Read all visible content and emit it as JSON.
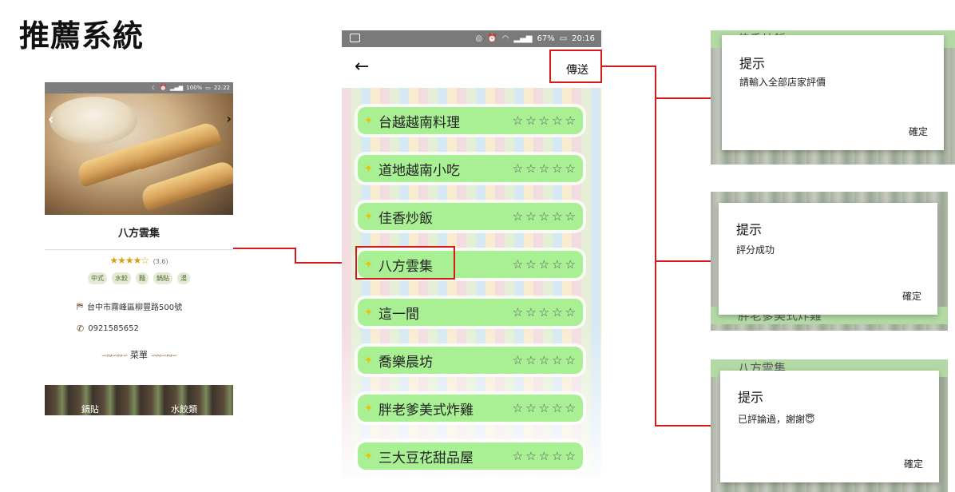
{
  "slide_title": "推薦系統",
  "left_phone": {
    "status_time": "22:22",
    "status_battery": "100%",
    "store_name": "八方雲集",
    "stars": "★★★★☆",
    "rating": "(3.6)",
    "tags": [
      "中式",
      "水餃",
      "麵",
      "鍋貼",
      "湯"
    ],
    "address": "台中市霧峰區柳豐路500號",
    "phone": "0921585652",
    "menu_title": "菜單",
    "menu_categories": [
      "鍋貼",
      "水餃類"
    ]
  },
  "mid_phone": {
    "status_battery": "67%",
    "status_time": "20:16",
    "back_icon": "←",
    "send_label": "傳送",
    "empty_stars": "☆☆☆☆☆",
    "stores": [
      {
        "name": "台越越南料理"
      },
      {
        "name": "道地越南小吃"
      },
      {
        "name": "佳香炒飯"
      },
      {
        "name": "八方雲集"
      },
      {
        "name": "這一間"
      },
      {
        "name": "喬樂晨坊"
      },
      {
        "name": "胖老爹美式炸雞"
      },
      {
        "name": "三大豆花甜品屋"
      }
    ]
  },
  "dialogs": [
    {
      "title": "提示",
      "message": "請輸入全部店家評價",
      "confirm": "確定",
      "peek_text": "佳香炒飯"
    },
    {
      "title": "提示",
      "message": "評分成功",
      "confirm": "確定",
      "peek_text": "胖老爹美式炸雞"
    },
    {
      "title": "提示",
      "message": "已評論過，謝謝",
      "emoji": "😇",
      "confirm": "確定",
      "peek_text": "八方雲集"
    }
  ],
  "colors": {
    "highlight": "#d51a1a",
    "row_green": "#a9f095",
    "star_gold": "#d4a017"
  }
}
